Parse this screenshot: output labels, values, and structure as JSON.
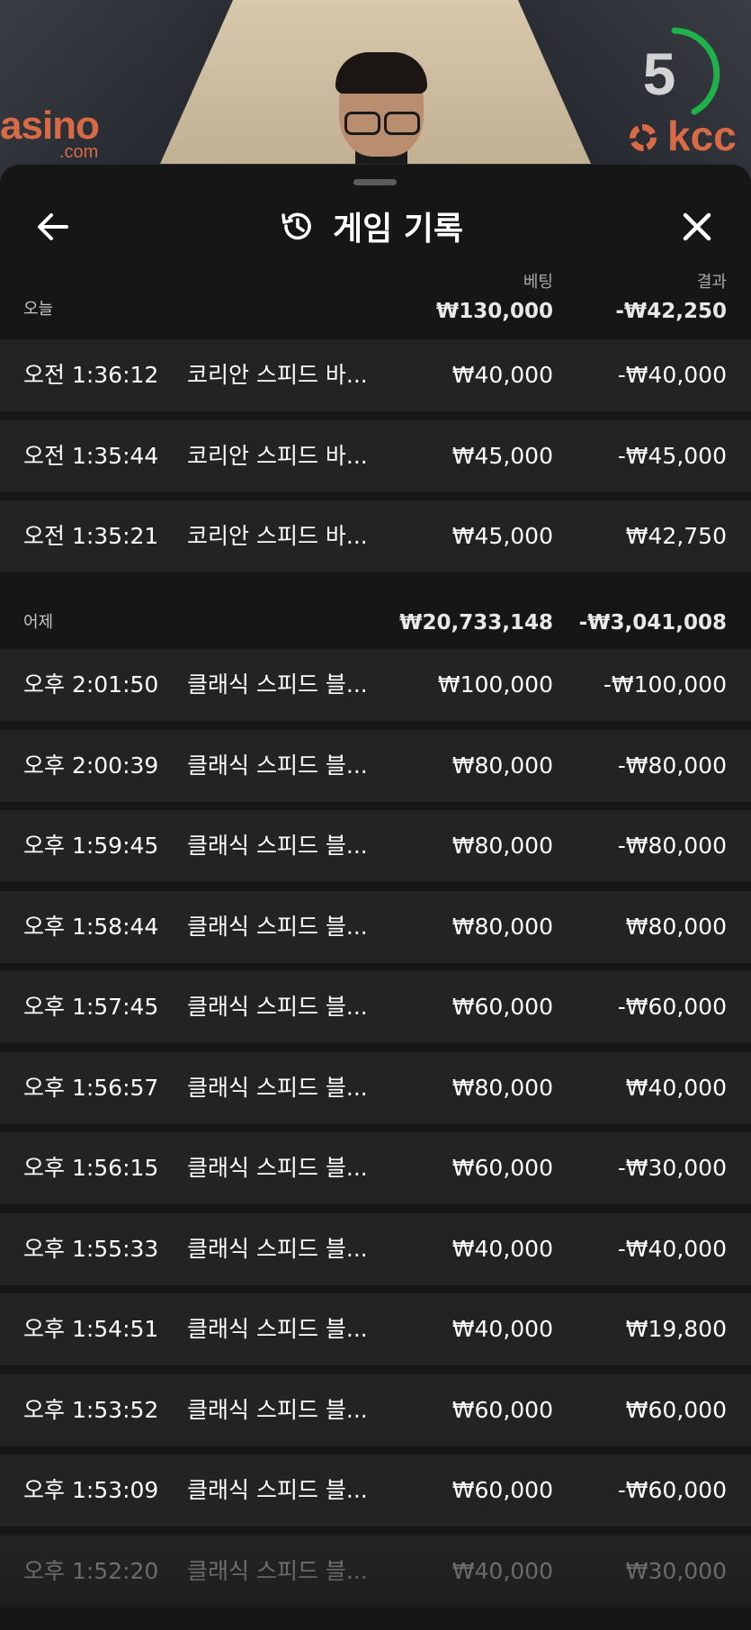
{
  "video": {
    "brand_left": "asino",
    "brand_left_sub": ".com",
    "brand_right": "kcc",
    "timer": "5",
    "timer_color": "#1fb24a",
    "brand_color": "#d86a45"
  },
  "sheet": {
    "title": "게임 기록",
    "title_icon": "history-icon",
    "back_icon": "arrow-left-icon",
    "close_icon": "close-icon",
    "col_bet": "베팅",
    "col_result": "결과"
  },
  "sections": [
    {
      "label": "오늘",
      "total_bet": "₩130,000",
      "total_result": "-₩42,250",
      "rows": [
        {
          "time": "오전 1:36:12",
          "game": "코리안 스피드 바...",
          "bet": "₩40,000",
          "result": "-₩40,000"
        },
        {
          "time": "오전 1:35:44",
          "game": "코리안 스피드 바...",
          "bet": "₩45,000",
          "result": "-₩45,000"
        },
        {
          "time": "오전 1:35:21",
          "game": "코리안 스피드 바...",
          "bet": "₩45,000",
          "result": "₩42,750"
        }
      ]
    },
    {
      "label": "어제",
      "total_bet": "₩20,733,148",
      "total_result": "-₩3,041,008",
      "rows": [
        {
          "time": "오후 2:01:50",
          "game": "클래식 스피드 블...",
          "bet": "₩100,000",
          "result": "-₩100,000"
        },
        {
          "time": "오후 2:00:39",
          "game": "클래식 스피드 블...",
          "bet": "₩80,000",
          "result": "-₩80,000"
        },
        {
          "time": "오후 1:59:45",
          "game": "클래식 스피드 블...",
          "bet": "₩80,000",
          "result": "-₩80,000"
        },
        {
          "time": "오후 1:58:44",
          "game": "클래식 스피드 블...",
          "bet": "₩80,000",
          "result": "₩80,000"
        },
        {
          "time": "오후 1:57:45",
          "game": "클래식 스피드 블...",
          "bet": "₩60,000",
          "result": "-₩60,000"
        },
        {
          "time": "오후 1:56:57",
          "game": "클래식 스피드 블...",
          "bet": "₩80,000",
          "result": "₩40,000"
        },
        {
          "time": "오후 1:56:15",
          "game": "클래식 스피드 블...",
          "bet": "₩60,000",
          "result": "-₩30,000"
        },
        {
          "time": "오후 1:55:33",
          "game": "클래식 스피드 블...",
          "bet": "₩40,000",
          "result": "-₩40,000"
        },
        {
          "time": "오후 1:54:51",
          "game": "클래식 스피드 블...",
          "bet": "₩40,000",
          "result": "₩19,800"
        },
        {
          "time": "오후 1:53:52",
          "game": "클래식 스피드 블...",
          "bet": "₩60,000",
          "result": "₩60,000"
        },
        {
          "time": "오후 1:53:09",
          "game": "클래식 스피드 블...",
          "bet": "₩60,000",
          "result": "-₩60,000"
        },
        {
          "time": "오후 1:52:20",
          "game": "클래식 스피드 블...",
          "bet": "₩40,000",
          "result": "₩30,000"
        }
      ]
    }
  ]
}
